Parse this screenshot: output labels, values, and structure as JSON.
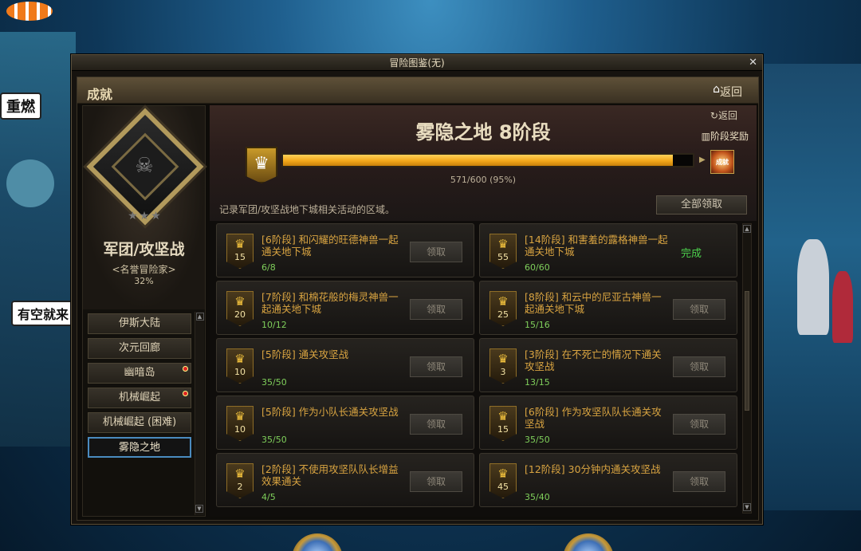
{
  "background": {
    "chat_1": "重燃",
    "chat_2": "有空就来"
  },
  "window": {
    "title": "冒险图鉴(无)",
    "close": "✕",
    "header_title": "成就",
    "home_icon": "home-icon",
    "back_label": "返回"
  },
  "left": {
    "guild_name": "军团/攻坚战",
    "rank": "<名誉冒险家>",
    "percent": "32%",
    "regions": [
      {
        "label": "伊斯大陆",
        "alert": false
      },
      {
        "label": "次元回廊",
        "alert": false
      },
      {
        "label": "幽暗岛",
        "alert": true
      },
      {
        "label": "机械崛起",
        "alert": true
      },
      {
        "label": "机械崛起 (困难)",
        "alert": false
      },
      {
        "label": "雾隐之地",
        "alert": false,
        "active": true
      }
    ]
  },
  "banner": {
    "stage_title": "雾隐之地  8阶段",
    "back": "返回",
    "stage_reward": "阶段奖励",
    "progress_current": 571,
    "progress_total": 600,
    "progress_text": "571/600 (95%)",
    "reward_icon_label": "成就",
    "description": "记录军团/攻坚战地下城相关活动的区域。",
    "claim_all": "全部领取"
  },
  "achievements": [
    {
      "badge": "15",
      "title": "[6阶段] 和闪耀的旺德神兽一起通关地下城",
      "progress": "6/8",
      "action": "领取",
      "done": false
    },
    {
      "badge": "55",
      "title": "[14阶段] 和害羞的露格神兽一起通关地下城",
      "progress": "60/60",
      "action": "完成",
      "done": true
    },
    {
      "badge": "20",
      "title": "[7阶段] 和棉花般的梅灵神兽一起通关地下城",
      "progress": "10/12",
      "action": "领取",
      "done": false
    },
    {
      "badge": "25",
      "title": "[8阶段] 和云中的尼亚古神兽一起通关地下城",
      "progress": "15/16",
      "action": "领取",
      "done": false
    },
    {
      "badge": "10",
      "title": "[5阶段] 通关攻坚战",
      "progress": "35/50",
      "action": "领取",
      "done": false
    },
    {
      "badge": "3",
      "title": "[3阶段] 在不死亡的情况下通关攻坚战",
      "progress": "13/15",
      "action": "领取",
      "done": false
    },
    {
      "badge": "10",
      "title": "[5阶段] 作为小队长通关攻坚战",
      "progress": "35/50",
      "action": "领取",
      "done": false
    },
    {
      "badge": "15",
      "title": "[6阶段] 作为攻坚队队长通关攻坚战",
      "progress": "35/50",
      "action": "领取",
      "done": false
    },
    {
      "badge": "2",
      "title": "[2阶段] 不使用攻坚队队长增益效果通关",
      "progress": "4/5",
      "action": "领取",
      "done": false
    },
    {
      "badge": "45",
      "title": "[12阶段] 30分钟内通关攻坚战",
      "progress": "35/40",
      "action": "领取",
      "done": false
    }
  ],
  "colors": {
    "accent_gold": "#f2a81a",
    "title_orange": "#d9a441",
    "progress_green": "#7fcf5b",
    "done_green": "#4cd04c",
    "active_region_border": "#4a8bbf"
  }
}
